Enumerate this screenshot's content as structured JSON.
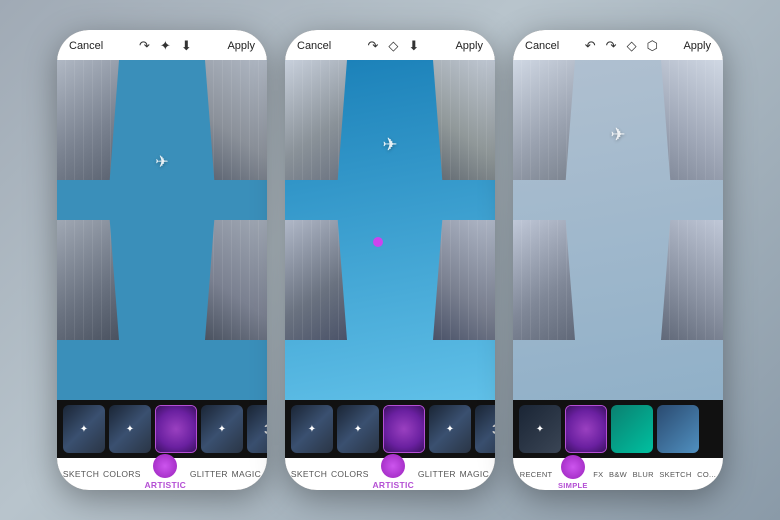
{
  "phones": [
    {
      "id": "phone1",
      "toolbar": {
        "cancel": "Cancel",
        "apply": "Apply",
        "icons": [
          "redo-icon",
          "brush-icon",
          "download-icon"
        ]
      },
      "filters": {
        "labels": [
          "SKETCH",
          "COLORS",
          "ARTISTIC",
          "GLITTER",
          "MAGIC"
        ],
        "active": "ARTISTIC",
        "active_index": 2
      }
    },
    {
      "id": "phone2",
      "toolbar": {
        "cancel": "Cancel",
        "apply": "Apply",
        "icons": [
          "redo-icon",
          "brush-icon",
          "download-icon"
        ]
      },
      "filters": {
        "labels": [
          "SKETCH",
          "COLORS",
          "ARTISTIC",
          "GLITTER",
          "MAGIC"
        ],
        "active": "ARTISTIC",
        "active_index": 2
      }
    },
    {
      "id": "phone3",
      "toolbar": {
        "cancel": "Cancel",
        "apply": "Apply",
        "icons": [
          "undo-icon",
          "redo-icon",
          "brush-icon",
          "layers-icon"
        ]
      },
      "filters": {
        "labels": [
          "RECENT",
          "SIMPLE",
          "FX",
          "B&W",
          "BLUR",
          "SKETCH",
          "CO..."
        ],
        "active": "SIMPLE",
        "active_index": 1
      }
    }
  ]
}
